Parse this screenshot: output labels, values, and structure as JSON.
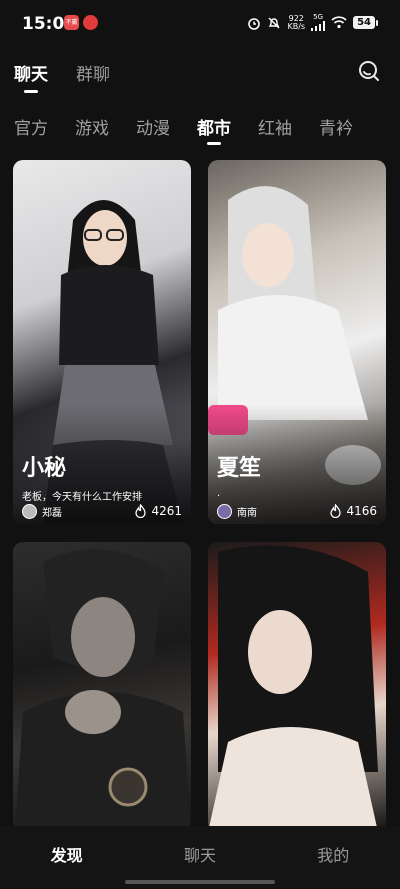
{
  "status": {
    "time": "15:07",
    "net_speed_value": "922",
    "net_speed_unit": "KB/s",
    "signal_label": "5G",
    "battery": "54",
    "app_icons": [
      "taobao-app-icon",
      "netease-music-app-icon"
    ],
    "app_icon_labels": [
      "不赢",
      ""
    ]
  },
  "top_tabs": [
    {
      "label": "聊天",
      "active": true
    },
    {
      "label": "群聊",
      "active": false
    }
  ],
  "categories": [
    {
      "label": "官方",
      "active": false
    },
    {
      "label": "游戏",
      "active": false
    },
    {
      "label": "动漫",
      "active": false
    },
    {
      "label": "都市",
      "active": true
    },
    {
      "label": "红袖",
      "active": false
    },
    {
      "label": "青衿",
      "active": false
    }
  ],
  "cards": [
    {
      "name": "小秘",
      "desc": "老板，今天有什么工作安排",
      "author": "郑磊",
      "heat": "4261"
    },
    {
      "name": "夏笙",
      "desc": ".",
      "author": "南南",
      "heat": "4166"
    },
    {
      "name": "",
      "desc": "",
      "author": "",
      "heat": ""
    },
    {
      "name": "",
      "desc": "",
      "author": "",
      "heat": ""
    }
  ],
  "bottom_nav": [
    {
      "label": "发现",
      "active": true
    },
    {
      "label": "聊天",
      "active": false
    },
    {
      "label": "我的",
      "active": false
    }
  ],
  "colors": {
    "background": "#111111",
    "accent": "#ffffff",
    "muted": "#9a9a9a"
  }
}
